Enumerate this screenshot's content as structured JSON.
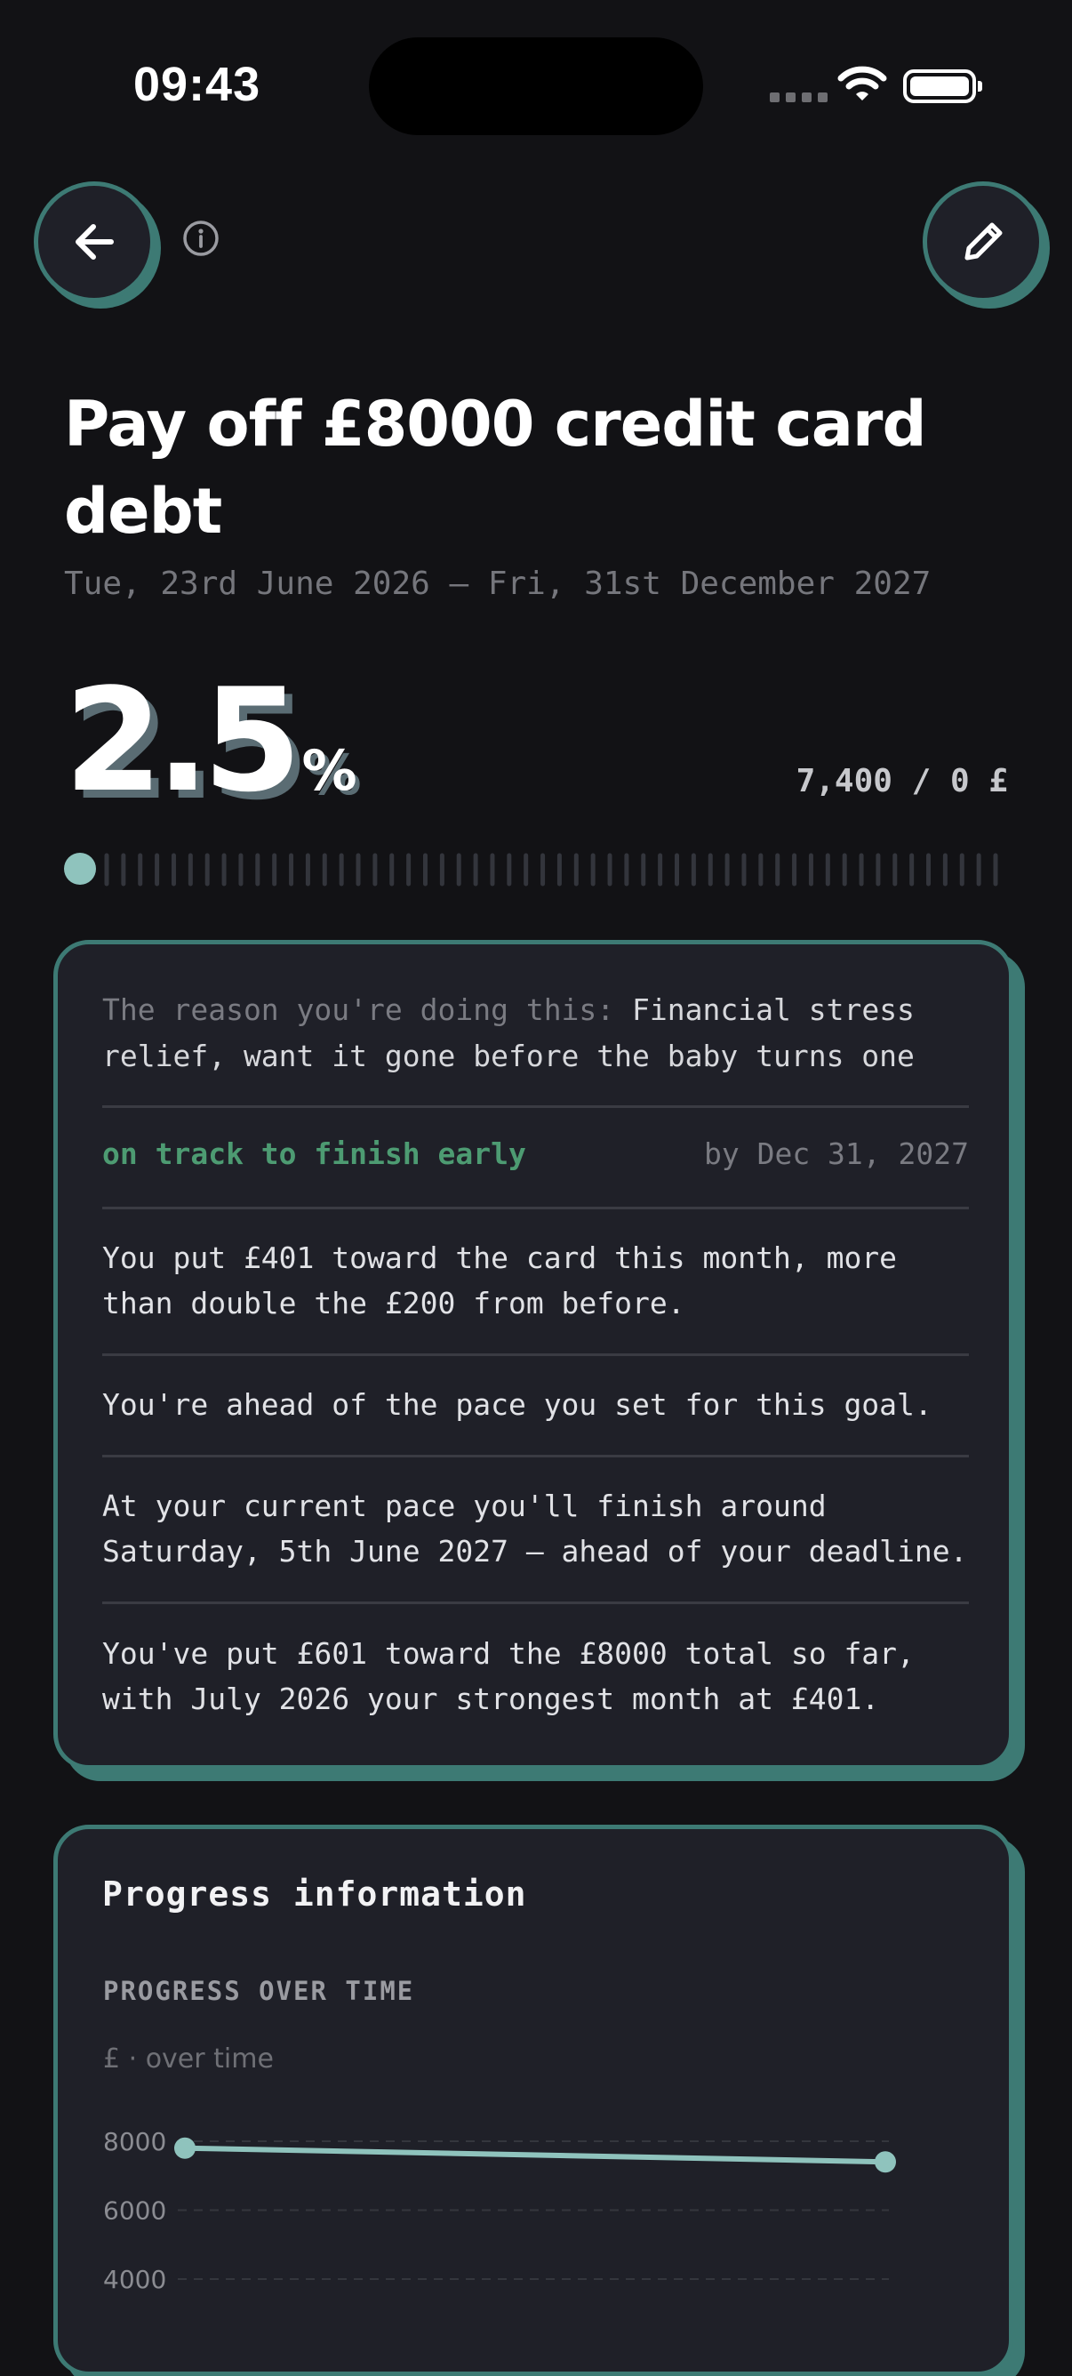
{
  "status_bar": {
    "time": "09:43"
  },
  "header": {
    "back_icon": "arrow-left-icon",
    "info_icon": "info-circle-icon",
    "edit_icon": "pencil-icon"
  },
  "goal": {
    "title": "Pay off £8000 credit card debt",
    "date_range": "Tue, 23rd June 2026 — Fri, 31st December 2027",
    "percent_value": "2.5",
    "percent_sign": "%",
    "percent_progress": 2.5,
    "amount_text": "7,400 / 0 £"
  },
  "summary_card": {
    "reason_label": "The reason you're doing this:",
    "reason_text": "Financial stress relief, want it gone before the baby turns one",
    "status": "on track to finish early",
    "deadline": "by Dec 31, 2027",
    "insights": [
      "You put £401 toward the card this month, more than double the £200 from before.",
      "You're ahead of the pace you set for this goal.",
      "At your current pace you'll finish around Saturday, 5th June 2027 — ahead of your deadline.",
      "You've put £601 toward the £8000 total so far, with July 2026 your strongest month at £401."
    ]
  },
  "progress_card": {
    "title": "Progress information",
    "subtitle": "PROGRESS OVER TIME",
    "unit_label": "£ · over time"
  },
  "colors": {
    "accent": "#3d7a74",
    "line": "#8fc3bd",
    "status_green": "#4d9b72",
    "background": "#121215",
    "card": "#1f2028"
  },
  "chart_data": {
    "type": "line",
    "y_ticks": [
      "8000",
      "6000",
      "4000"
    ],
    "series": [
      {
        "values": [
          7800,
          7400
        ]
      }
    ],
    "ylim": [
      4000,
      8000
    ],
    "grid": true
  }
}
